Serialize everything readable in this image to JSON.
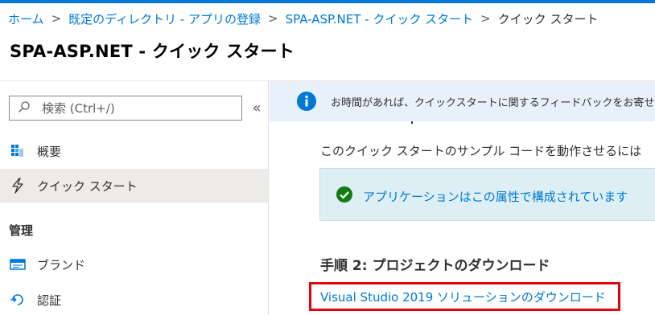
{
  "breadcrumb": {
    "items": [
      "ホーム",
      "既定のディレクトリ - アプリの登録",
      "SPA-ASP.NET - クイック スタート"
    ],
    "current": "クイック スタート",
    "separator": ">"
  },
  "page": {
    "title": "SPA-ASP.NET - クイック スタート"
  },
  "sidebar": {
    "search_placeholder": "検索 (Ctrl+/)",
    "collapse_glyph": "«",
    "items": [
      {
        "label": "概要",
        "icon": "overview-grid-icon"
      },
      {
        "label": "クイック スタート",
        "icon": "lightning-icon",
        "active": true
      }
    ],
    "section_title": "管理",
    "manage_items": [
      {
        "label": "ブランド",
        "icon": "branding-icon"
      },
      {
        "label": "認証",
        "icon": "auth-icon"
      }
    ]
  },
  "main": {
    "feedback": "お時間があれば、クイックスタートに関するフィードバックをお寄せください",
    "intro": "このクイック スタートのサンプル コードを動作させるには",
    "success_message": "アプリケーションはこの属性で構成されています",
    "step_heading": "手順 2: プロジェクトのダウンロード",
    "download_link": "Visual Studio 2019 ソリューションのダウンロード"
  },
  "colors": {
    "accent": "#0078d4",
    "highlight_border": "#e3000f",
    "success": "#107c10",
    "info_bar": "#e8f1fb"
  }
}
